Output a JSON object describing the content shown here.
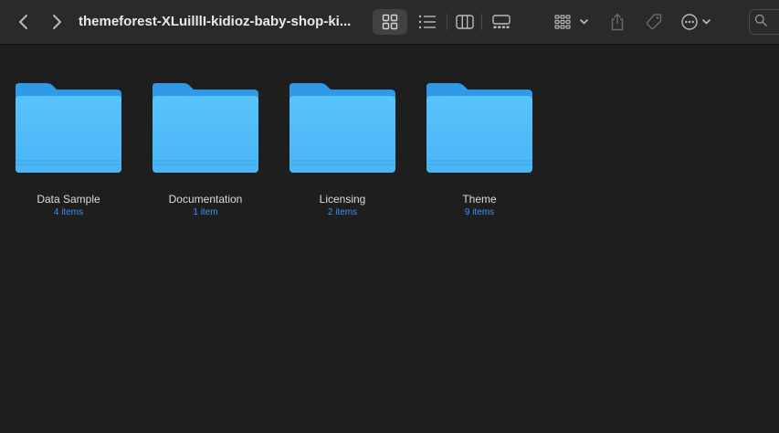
{
  "window": {
    "title": "themeforest-XLuilllI-kidioz-baby-shop-ki..."
  },
  "toolbar": {
    "back_icon": "chevron-left-icon",
    "forward_icon": "chevron-right-icon",
    "views": [
      {
        "name": "icon-view",
        "icon": "grid-icon",
        "active": true
      },
      {
        "name": "list-view",
        "icon": "list-icon",
        "active": false
      },
      {
        "name": "column-view",
        "icon": "columns-icon",
        "active": false
      },
      {
        "name": "gallery-view",
        "icon": "gallery-icon",
        "active": false
      }
    ],
    "group_icon": "group-icon",
    "share_icon": "share-icon",
    "tag_icon": "tag-icon",
    "more_icon": "ellipsis-circle-icon",
    "search_icon": "search-icon"
  },
  "colors": {
    "background": "#1e1e1e",
    "toolbar": "#2b2a2b",
    "folder_top": "#5ac8ff",
    "folder_tab": "#2f9ae8",
    "count_text": "#3d8ff5"
  },
  "items": [
    {
      "name": "Data Sample",
      "count": "4 items"
    },
    {
      "name": "Documentation",
      "count": "1 item"
    },
    {
      "name": "Licensing",
      "count": "2 items"
    },
    {
      "name": "Theme",
      "count": "9 items"
    }
  ]
}
